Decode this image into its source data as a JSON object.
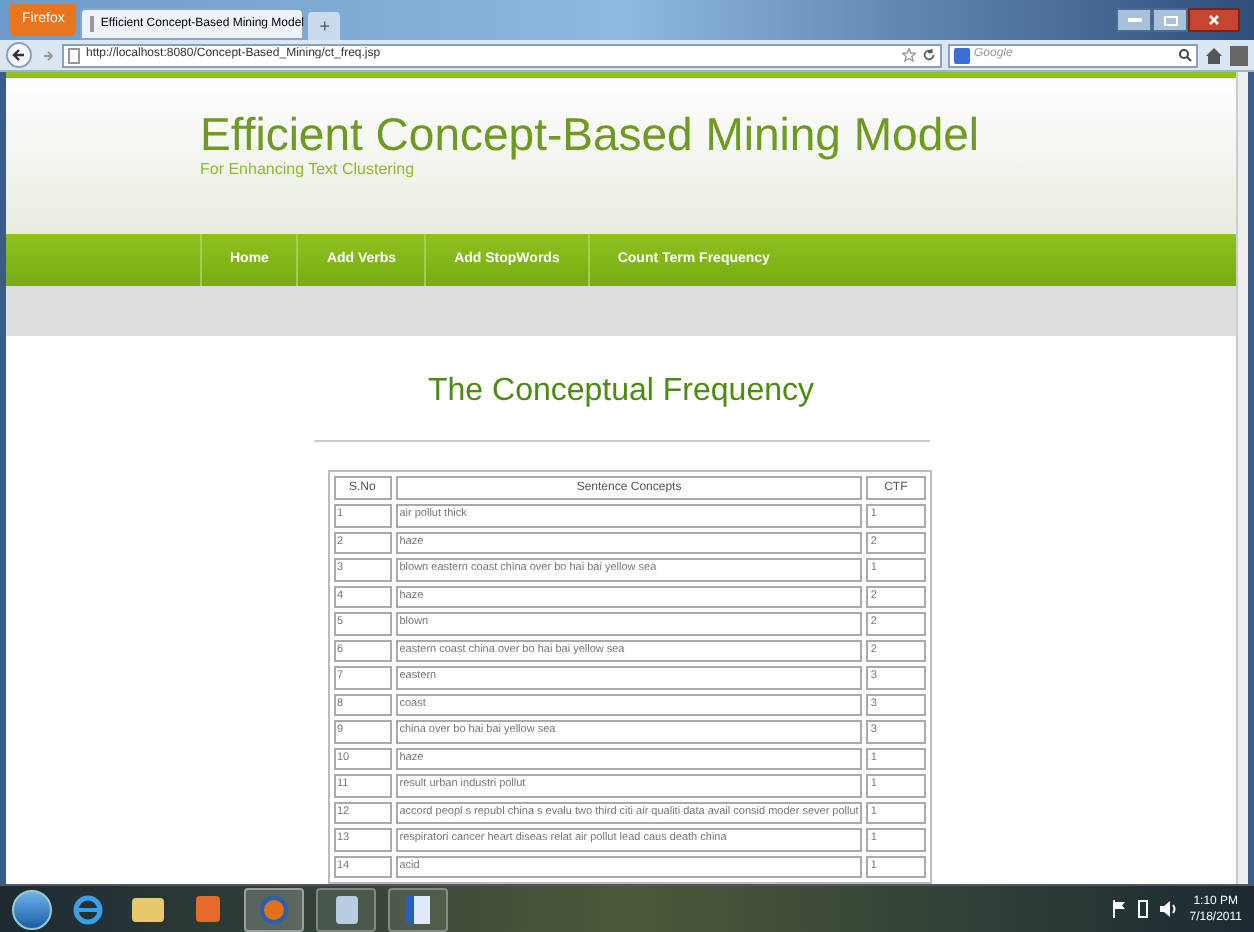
{
  "browser": {
    "menu_button": "Firefox",
    "tab_title": "Efficient Concept-Based Mining Model",
    "new_tab": "+",
    "url": "http://localhost:8080/Concept-Based_Mining/ct_freq.jsp",
    "search": {
      "placeholder": "Google"
    }
  },
  "site": {
    "title": "Efficient Concept-Based Mining Model",
    "subtitle": "For Enhancing Text Clustering",
    "nav": [
      "Home",
      "Add Verbs",
      "Add StopWords",
      "Count Term Frequency"
    ]
  },
  "heading": "The Conceptual Frequency",
  "table": {
    "columns": [
      "S.No",
      "Sentence Concepts",
      "CTF"
    ],
    "rows": [
      [
        "1",
        "air pollut thick",
        "1"
      ],
      [
        "2",
        "haze",
        "2"
      ],
      [
        "3",
        "blown eastern coast china over bo hai bai yellow sea",
        "1"
      ],
      [
        "4",
        "haze",
        "2"
      ],
      [
        "5",
        "blown",
        "2"
      ],
      [
        "6",
        "eastern coast china over bo hai bai yellow sea",
        "2"
      ],
      [
        "7",
        "eastern",
        "3"
      ],
      [
        "8",
        "coast",
        "3"
      ],
      [
        "9",
        "china over bo hai bai yellow sea",
        "3"
      ],
      [
        "10",
        "haze",
        "1"
      ],
      [
        "11",
        "result urban industri pollut",
        "1"
      ],
      [
        "12",
        "accord peopl s republ china s evalu two third citi air qualiti data avail consid moder sever pollut",
        "1"
      ],
      [
        "13",
        "respiratori cancer heart diseas relat air pollut lead caus death china",
        "1"
      ],
      [
        "14",
        "acid",
        "1"
      ]
    ]
  },
  "taskbar": {
    "time": "1:10 PM",
    "date": "7/18/2011"
  }
}
